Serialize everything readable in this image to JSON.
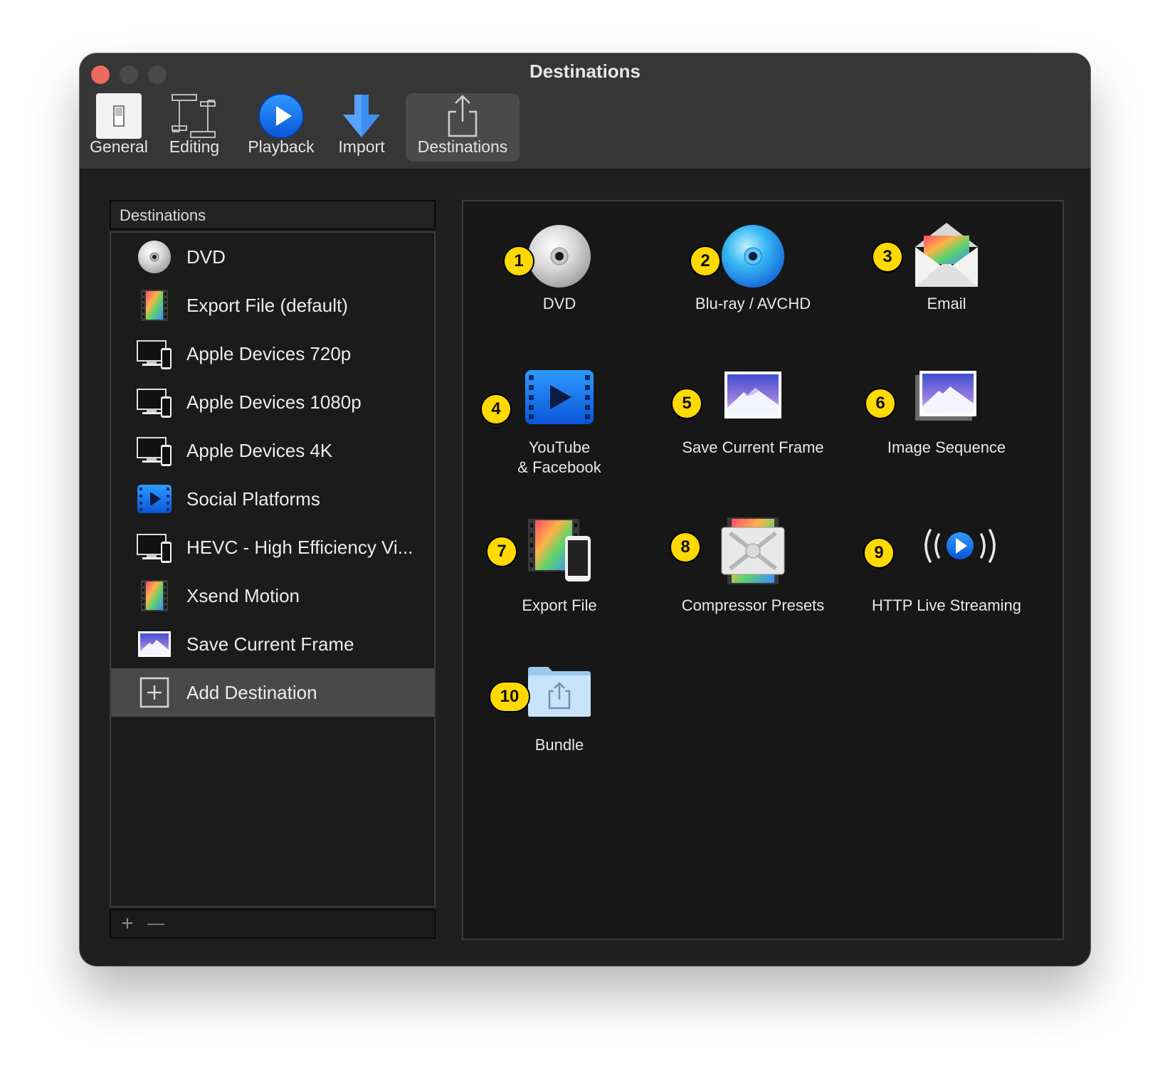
{
  "window": {
    "title": "Destinations"
  },
  "toolbar": {
    "items": [
      {
        "label": "General",
        "icon": "switch-icon"
      },
      {
        "label": "Editing",
        "icon": "film-edit-icon"
      },
      {
        "label": "Playback",
        "icon": "play-circle-icon"
      },
      {
        "label": "Import",
        "icon": "download-arrow-icon"
      },
      {
        "label": "Destinations",
        "icon": "share-icon",
        "selected": true
      }
    ]
  },
  "sidebar": {
    "header": "Destinations",
    "items": [
      {
        "label": "DVD",
        "icon": "dvd-disc-icon"
      },
      {
        "label": "Export File (default)",
        "icon": "film-icon"
      },
      {
        "label": "Apple Devices 720p",
        "icon": "devices-icon"
      },
      {
        "label": "Apple Devices 1080p",
        "icon": "devices-icon"
      },
      {
        "label": "Apple Devices 4K",
        "icon": "devices-icon"
      },
      {
        "label": "Social Platforms",
        "icon": "video-play-icon"
      },
      {
        "label": "HEVC - High Efficiency Vi...",
        "icon": "devices-icon"
      },
      {
        "label": "Xsend Motion",
        "icon": "film-icon"
      },
      {
        "label": "Save Current Frame",
        "icon": "mountain-photo-icon"
      },
      {
        "label": "Add Destination",
        "icon": "plus-square-icon",
        "selected": true
      }
    ],
    "footer": {
      "add": "+",
      "remove": "—"
    }
  },
  "destinations": [
    {
      "number": "1",
      "label": "DVD",
      "icon": "dvd-disc-icon"
    },
    {
      "number": "2",
      "label": "Blu-ray / AVCHD",
      "icon": "bluray-disc-icon"
    },
    {
      "number": "3",
      "label": "Email",
      "icon": "envelope-icon"
    },
    {
      "number": "4",
      "label": "YouTube\n& Facebook",
      "icon": "video-play-icon"
    },
    {
      "number": "5",
      "label": "Save Current Frame",
      "icon": "mountain-photo-icon"
    },
    {
      "number": "6",
      "label": "Image Sequence",
      "icon": "photo-stack-icon"
    },
    {
      "number": "7",
      "label": "Export File",
      "icon": "film-phone-icon"
    },
    {
      "number": "8",
      "label": "Compressor Presets",
      "icon": "compressor-icon"
    },
    {
      "number": "9",
      "label": "HTTP Live Streaming",
      "icon": "broadcast-icon"
    },
    {
      "number": "10",
      "label": "Bundle",
      "icon": "folder-share-icon"
    }
  ],
  "colors": {
    "badge": "#ffd900",
    "window_bg": "#1f1f1f",
    "selected_row": "#494949",
    "accent_blue": "#1e7cf2"
  }
}
